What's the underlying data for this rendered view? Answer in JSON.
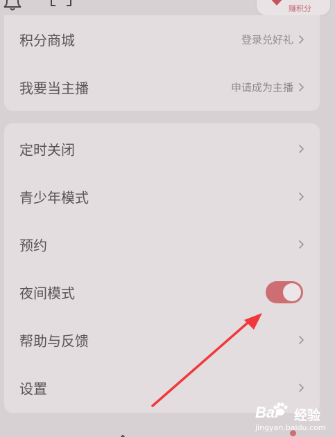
{
  "header": {
    "bell_icon": "bell-icon",
    "scan_icon": "scan-icon",
    "earn_points": {
      "icon": "heart-icon",
      "label": "赚积分"
    }
  },
  "card_account": {
    "items": [
      {
        "label": "积分商城",
        "hint": "登录兑好礼",
        "icon": "chevron-right-icon"
      },
      {
        "label": "我要当主播",
        "hint": "申请成为主播",
        "icon": "chevron-right-icon"
      }
    ]
  },
  "card_settings": {
    "items": [
      {
        "label": "定时关闭",
        "icon": "chevron-right-icon"
      },
      {
        "label": "青少年模式",
        "icon": "chevron-right-icon"
      },
      {
        "label": "预约",
        "icon": "chevron-right-icon"
      },
      {
        "label": "夜间模式",
        "toggle_on": true
      },
      {
        "label": "帮助与反馈",
        "icon": "chevron-right-icon"
      },
      {
        "label": "设置",
        "icon": "chevron-right-icon"
      }
    ]
  },
  "annotation": {
    "arrow_color": "#f0393c"
  },
  "watermark": {
    "brand": "Bai",
    "brand_cn": "经验",
    "url": "jingyan.baidu.com"
  },
  "colors": {
    "accent": "#cd6f72",
    "card_bg": "#e4dde0",
    "page_bg": "#d8d1d3",
    "text": "#585456",
    "hint_text": "#8e8a8c"
  }
}
